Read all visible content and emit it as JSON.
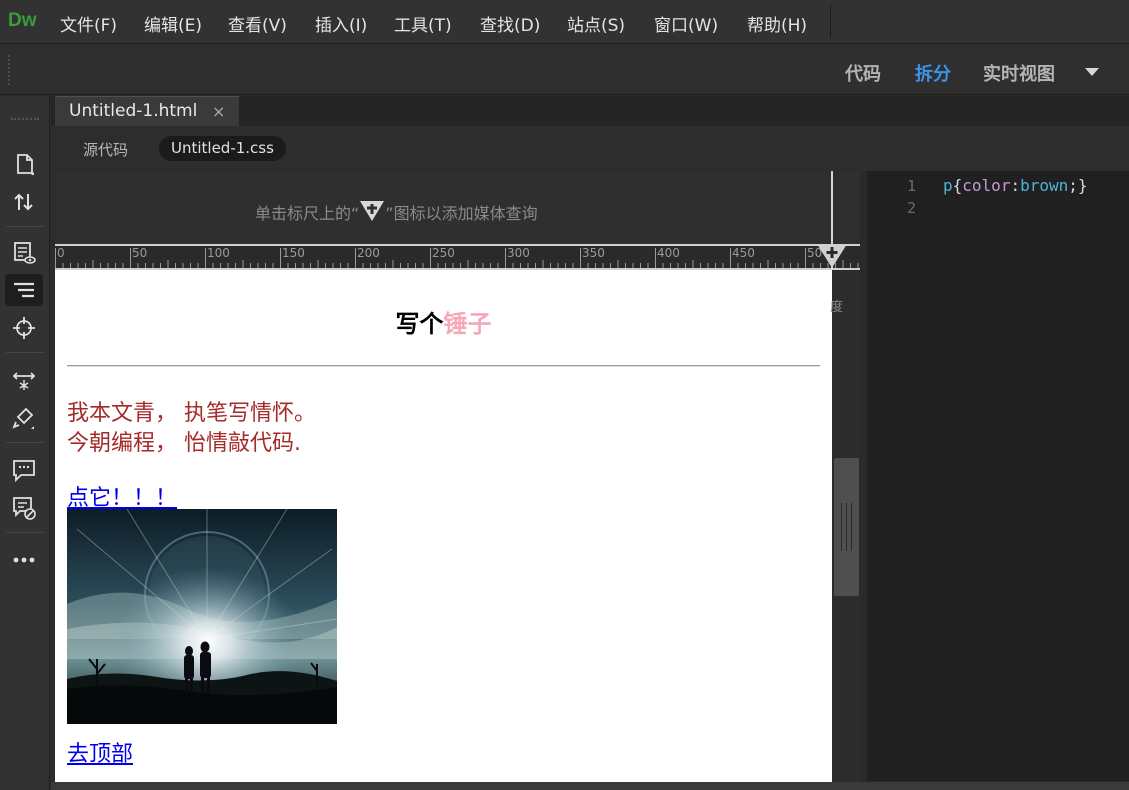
{
  "app": {
    "logo": "Dw"
  },
  "menu": {
    "items": [
      "文件(F)",
      "编辑(E)",
      "查看(V)",
      "插入(I)",
      "工具(T)",
      "查找(D)",
      "站点(S)",
      "窗口(W)",
      "帮助(H)"
    ]
  },
  "view_switch": {
    "code": "代码",
    "split": "拆分",
    "live": "实时视图",
    "active": "split",
    "active_color": "#3d94e8"
  },
  "tools": [
    "new-file-icon",
    "transfer-icon",
    "live-preview-icon",
    "dom-icon",
    "target-icon",
    "resize-icon",
    "brush-icon",
    "comment-icon",
    "comment-off-icon",
    "more-icon"
  ],
  "document": {
    "tab_label": "Untitled-1.html",
    "close": "×"
  },
  "related_files": {
    "source": "源代码",
    "css": "Untitled-1.css"
  },
  "media_query": {
    "hint_prefix": "单击标尺上的“",
    "hint_suffix": "”图标以添加媒体查询"
  },
  "ruler": {
    "labels": [
      "0",
      "50",
      "100",
      "150",
      "200",
      "250",
      "300",
      "350",
      "400",
      "450",
      "50"
    ]
  },
  "live_view": {
    "title_part1": "写个",
    "title_part2": "锤子",
    "title_accent_color": "#f5a9b8",
    "poem_line1": "我本文青， 执笔写情怀。",
    "poem_line2": "今朝编程， 怡情敲代码.",
    "poem_color": "brown",
    "link_click": "点它！！！",
    "link_top": "去顶部"
  },
  "gutter": {
    "fragment": "度"
  },
  "code": {
    "line_numbers": [
      "1",
      "2"
    ],
    "selector": "p",
    "open": "{",
    "property": "color",
    "colon": ":",
    "value": "brown",
    "close": ";}"
  }
}
